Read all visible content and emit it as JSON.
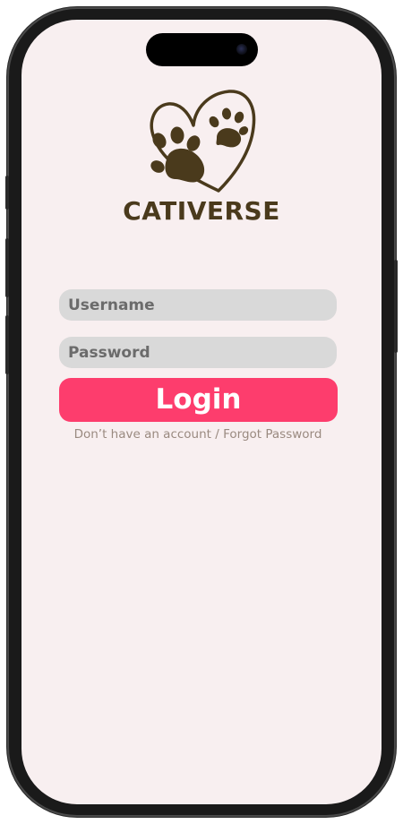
{
  "app": {
    "brand_name": "CATIVERSE",
    "logo_icon": "heart-paws-icon"
  },
  "login_form": {
    "username_placeholder": "Username",
    "username_value": "",
    "password_placeholder": "Password",
    "password_value": "",
    "login_label": "Login",
    "signup_link": "Don’t have an account",
    "separator": " / ",
    "forgot_link": "Forgot Password"
  },
  "colors": {
    "background": "#f8eff0",
    "brand": "#4a3a1c",
    "field": "#d9d9d9",
    "placeholder": "#6b6b6b",
    "accent": "#fd3d6d",
    "muted_link": "#9a8a80"
  }
}
